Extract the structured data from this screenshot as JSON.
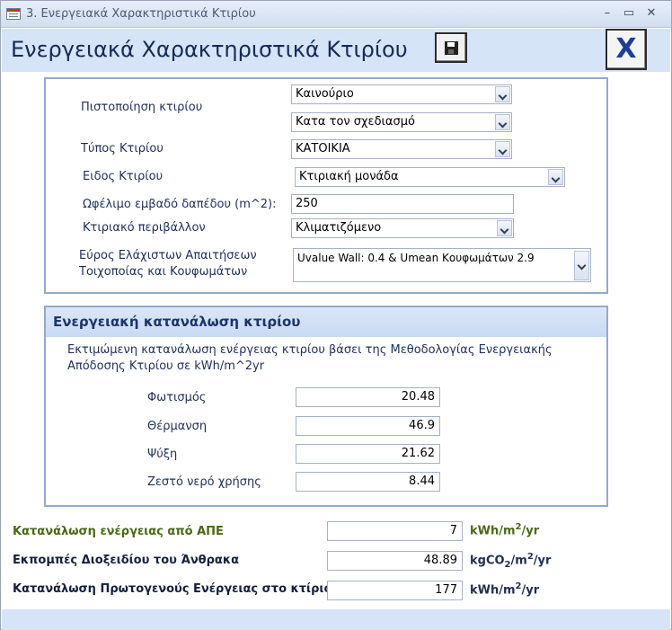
{
  "window": {
    "title": "3. Ενεργειακά Χαρακτηριστικά Κτιρίου",
    "minimize_glyph": "–",
    "maximize_glyph": "▭",
    "close_glyph": "✕"
  },
  "header": {
    "title": "Ενεργειακά Χαρακτηριστικά Κτιρίου",
    "close_label": "X",
    "save_icon": "floppy-disk-icon"
  },
  "building": {
    "certification_label": "Πιστοποίηση κτιρίου",
    "certification_value_1": "Καινούριο",
    "certification_value_2": "Κατα τον σχεδιασμό",
    "type_label": "Τύπος Κτιρίου",
    "type_value": "ΚΑΤΟΙΚΙΑ",
    "kind_label": "Ειδος Κτιρίου",
    "kind_value": "Κτιριακή μονάδα",
    "area_label": "Ωφέλιμο εμβαδό δαπέδου (m^2):",
    "area_value": "250",
    "environment_label": "Κτιριακό περιβάλλον",
    "environment_value": "Κλιματιζόμενο",
    "requirements_label_1": "Εύρος Ελάχιστων Απαιτήσεων",
    "requirements_label_2": "Τοιχοποίας και Κουφωμάτων",
    "requirements_value": "Uvalue Wall: 0.4 & Umean Κουφωμάτων 2.9"
  },
  "consumption": {
    "title": "Ενεργειακή κατανάλωση κτιρίου",
    "description": "Εκτιμώμενη κατανάλωση ενέργειας κτιρίου βάσει της Μεθοδολογίας Ενεργειακής Απόδοσης Κτιρίου σε kWh/m^2yr",
    "rows": [
      {
        "label": "Φωτισμός",
        "value": "20.48"
      },
      {
        "label": "Θέρμανση",
        "value": "46.9"
      },
      {
        "label": "Ψύξη",
        "value": "21.62"
      },
      {
        "label": "Ζεστό νερό χρήσης",
        "value": "8.44"
      }
    ]
  },
  "totals": {
    "renewable_label": "Κατανάλωση ενέργειας από ΑΠΕ",
    "renewable_value": "7",
    "renewable_unit_a": "kWh/m",
    "renewable_unit_sup": "2",
    "renewable_unit_b": "/yr",
    "co2_label": "Εκπομπές Διοξειδίου του Άνθρακα",
    "co2_value": "48.89",
    "co2_unit_a": "kgCO",
    "co2_unit_sub": "2",
    "co2_unit_b": "/m",
    "co2_unit_sup": "2",
    "co2_unit_c": "/yr",
    "primary_label": "Κατανάλωση Πρωτογενούς Ενέργειας στο κτίριο",
    "primary_value": "177",
    "primary_unit_a": "kWh/m",
    "primary_unit_sup": "2",
    "primary_unit_b": "/yr"
  }
}
